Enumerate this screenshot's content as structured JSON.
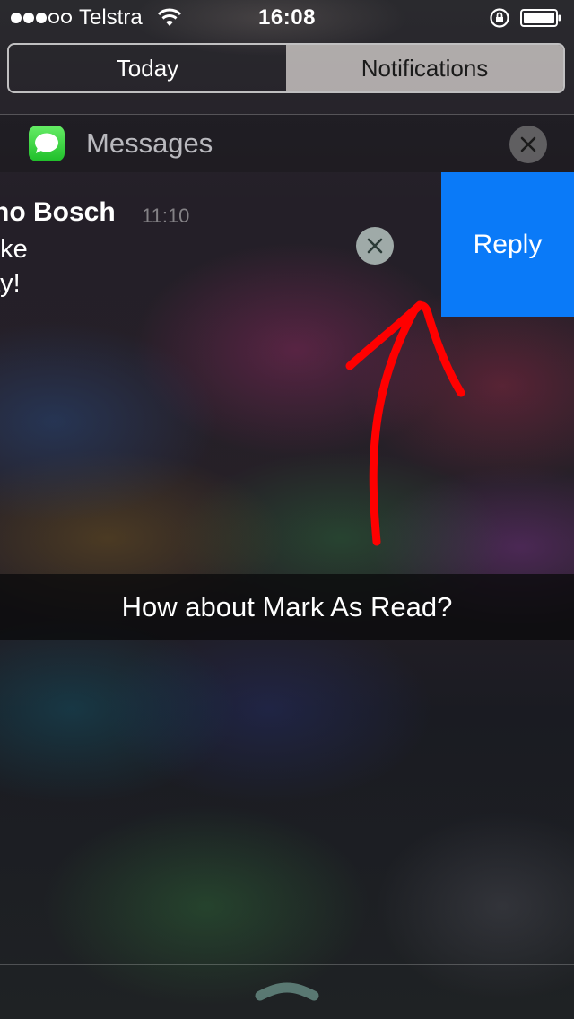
{
  "status_bar": {
    "carrier": "Telstra",
    "time": "16:08",
    "signal_bars_filled": 3,
    "signal_bars_total": 5
  },
  "segmented_control": {
    "today_label": "Today",
    "notifications_label": "Notifications",
    "selected": "Notifications"
  },
  "messages_group": {
    "app_name": "Messages",
    "notification": {
      "sender": "no Bosch",
      "time": "11:10",
      "body_line_1": "oke",
      "body_line_2": "ay!",
      "action_label": "Reply"
    }
  },
  "caption": "How about Mark As Read?",
  "colors": {
    "reply_button": "#0a7af8",
    "annotation_arrow": "#ff0000",
    "messages_icon": "#2cc83a"
  },
  "icons": {
    "wifi": "wifi-icon",
    "lock": "rotation-lock-icon",
    "battery": "battery-icon",
    "app": "messages-app-icon",
    "close": "close-icon",
    "grabber": "chevron-up-icon"
  }
}
